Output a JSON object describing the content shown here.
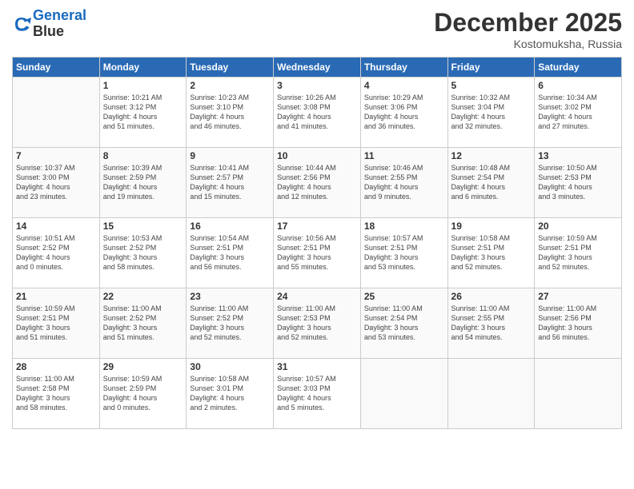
{
  "header": {
    "logo": {
      "line1": "General",
      "line2": "Blue"
    },
    "title": "December 2025",
    "location": "Kostomuksha, Russia"
  },
  "days_of_week": [
    "Sunday",
    "Monday",
    "Tuesday",
    "Wednesday",
    "Thursday",
    "Friday",
    "Saturday"
  ],
  "weeks": [
    [
      {
        "day": "",
        "info": ""
      },
      {
        "day": "1",
        "info": "Sunrise: 10:21 AM\nSunset: 3:12 PM\nDaylight: 4 hours\nand 51 minutes."
      },
      {
        "day": "2",
        "info": "Sunrise: 10:23 AM\nSunset: 3:10 PM\nDaylight: 4 hours\nand 46 minutes."
      },
      {
        "day": "3",
        "info": "Sunrise: 10:26 AM\nSunset: 3:08 PM\nDaylight: 4 hours\nand 41 minutes."
      },
      {
        "day": "4",
        "info": "Sunrise: 10:29 AM\nSunset: 3:06 PM\nDaylight: 4 hours\nand 36 minutes."
      },
      {
        "day": "5",
        "info": "Sunrise: 10:32 AM\nSunset: 3:04 PM\nDaylight: 4 hours\nand 32 minutes."
      },
      {
        "day": "6",
        "info": "Sunrise: 10:34 AM\nSunset: 3:02 PM\nDaylight: 4 hours\nand 27 minutes."
      }
    ],
    [
      {
        "day": "7",
        "info": "Sunrise: 10:37 AM\nSunset: 3:00 PM\nDaylight: 4 hours\nand 23 minutes."
      },
      {
        "day": "8",
        "info": "Sunrise: 10:39 AM\nSunset: 2:59 PM\nDaylight: 4 hours\nand 19 minutes."
      },
      {
        "day": "9",
        "info": "Sunrise: 10:41 AM\nSunset: 2:57 PM\nDaylight: 4 hours\nand 15 minutes."
      },
      {
        "day": "10",
        "info": "Sunrise: 10:44 AM\nSunset: 2:56 PM\nDaylight: 4 hours\nand 12 minutes."
      },
      {
        "day": "11",
        "info": "Sunrise: 10:46 AM\nSunset: 2:55 PM\nDaylight: 4 hours\nand 9 minutes."
      },
      {
        "day": "12",
        "info": "Sunrise: 10:48 AM\nSunset: 2:54 PM\nDaylight: 4 hours\nand 6 minutes."
      },
      {
        "day": "13",
        "info": "Sunrise: 10:50 AM\nSunset: 2:53 PM\nDaylight: 4 hours\nand 3 minutes."
      }
    ],
    [
      {
        "day": "14",
        "info": "Sunrise: 10:51 AM\nSunset: 2:52 PM\nDaylight: 4 hours\nand 0 minutes."
      },
      {
        "day": "15",
        "info": "Sunrise: 10:53 AM\nSunset: 2:52 PM\nDaylight: 3 hours\nand 58 minutes."
      },
      {
        "day": "16",
        "info": "Sunrise: 10:54 AM\nSunset: 2:51 PM\nDaylight: 3 hours\nand 56 minutes."
      },
      {
        "day": "17",
        "info": "Sunrise: 10:56 AM\nSunset: 2:51 PM\nDaylight: 3 hours\nand 55 minutes."
      },
      {
        "day": "18",
        "info": "Sunrise: 10:57 AM\nSunset: 2:51 PM\nDaylight: 3 hours\nand 53 minutes."
      },
      {
        "day": "19",
        "info": "Sunrise: 10:58 AM\nSunset: 2:51 PM\nDaylight: 3 hours\nand 52 minutes."
      },
      {
        "day": "20",
        "info": "Sunrise: 10:59 AM\nSunset: 2:51 PM\nDaylight: 3 hours\nand 52 minutes."
      }
    ],
    [
      {
        "day": "21",
        "info": "Sunrise: 10:59 AM\nSunset: 2:51 PM\nDaylight: 3 hours\nand 51 minutes."
      },
      {
        "day": "22",
        "info": "Sunrise: 11:00 AM\nSunset: 2:52 PM\nDaylight: 3 hours\nand 51 minutes."
      },
      {
        "day": "23",
        "info": "Sunrise: 11:00 AM\nSunset: 2:52 PM\nDaylight: 3 hours\nand 52 minutes."
      },
      {
        "day": "24",
        "info": "Sunrise: 11:00 AM\nSunset: 2:53 PM\nDaylight: 3 hours\nand 52 minutes."
      },
      {
        "day": "25",
        "info": "Sunrise: 11:00 AM\nSunset: 2:54 PM\nDaylight: 3 hours\nand 53 minutes."
      },
      {
        "day": "26",
        "info": "Sunrise: 11:00 AM\nSunset: 2:55 PM\nDaylight: 3 hours\nand 54 minutes."
      },
      {
        "day": "27",
        "info": "Sunrise: 11:00 AM\nSunset: 2:56 PM\nDaylight: 3 hours\nand 56 minutes."
      }
    ],
    [
      {
        "day": "28",
        "info": "Sunrise: 11:00 AM\nSunset: 2:58 PM\nDaylight: 3 hours\nand 58 minutes."
      },
      {
        "day": "29",
        "info": "Sunrise: 10:59 AM\nSunset: 2:59 PM\nDaylight: 4 hours\nand 0 minutes."
      },
      {
        "day": "30",
        "info": "Sunrise: 10:58 AM\nSunset: 3:01 PM\nDaylight: 4 hours\nand 2 minutes."
      },
      {
        "day": "31",
        "info": "Sunrise: 10:57 AM\nSunset: 3:03 PM\nDaylight: 4 hours\nand 5 minutes."
      },
      {
        "day": "",
        "info": ""
      },
      {
        "day": "",
        "info": ""
      },
      {
        "day": "",
        "info": ""
      }
    ]
  ]
}
